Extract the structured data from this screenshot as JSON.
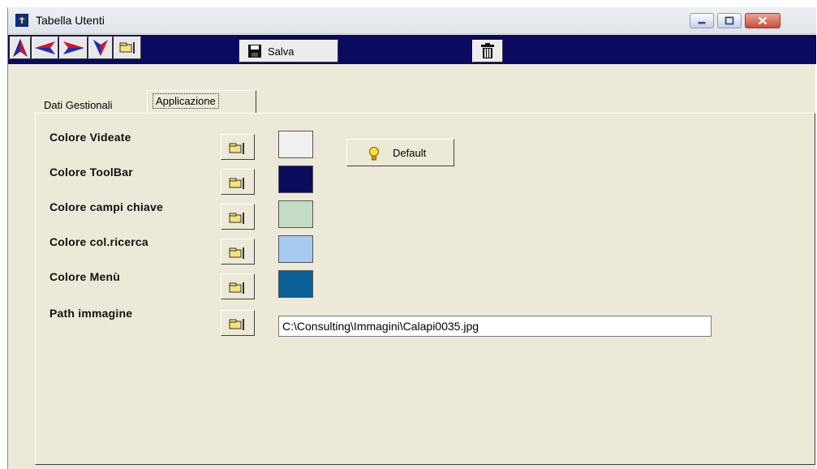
{
  "window": {
    "title": "Tabella Utenti"
  },
  "toolbar": {
    "nav_buttons": [
      "arrow-up-icon",
      "arrow-left-icon",
      "arrow-right-icon",
      "arrow-down-icon",
      "pointer-hand-icon"
    ],
    "save_label": "Salva",
    "delete_icon": "trash-icon"
  },
  "tabs": [
    {
      "label": "Dati Gestionali",
      "active": false
    },
    {
      "label": "Applicazione",
      "active": true
    }
  ],
  "settings": {
    "colore_videate": {
      "label": "Colore Videate",
      "color": "#f0f0f0"
    },
    "colore_toolbar": {
      "label": "Colore ToolBar",
      "color": "#0b0b5c"
    },
    "colore_campi_chiave": {
      "label": "Colore campi chiave",
      "color": "#c3dcc3"
    },
    "colore_col_ricerca": {
      "label": "Colore col.ricerca",
      "color": "#a6caf0"
    },
    "colore_menu": {
      "label": "Colore Menù",
      "color": "#0b6096"
    },
    "path_immagine": {
      "label": "Path immagine",
      "value": "C:\\Consulting\\Immagini\\Calapi0035.jpg"
    }
  },
  "default_button": {
    "label": "Default",
    "icon": "lightbulb-icon"
  }
}
